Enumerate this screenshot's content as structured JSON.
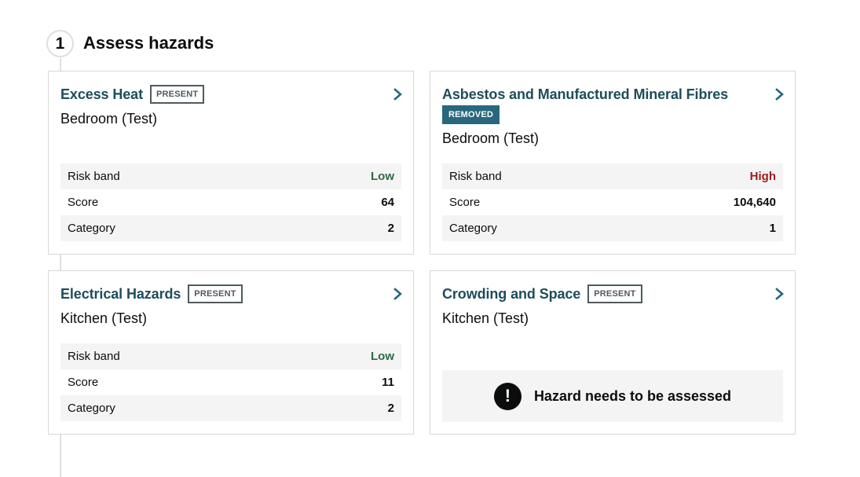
{
  "step": {
    "number": "1",
    "title": "Assess hazards"
  },
  "colors": {
    "link": "#1d4d5c",
    "tag_solid": "#27687e",
    "low": "#2d6a44",
    "high": "#a11d1d"
  },
  "cards": [
    {
      "title": "Excess Heat",
      "tag": "PRESENT",
      "location": "Bedroom (Test)",
      "rows": [
        {
          "label": "Risk band",
          "value": "Low"
        },
        {
          "label": "Score",
          "value": "64"
        },
        {
          "label": "Category",
          "value": "2"
        }
      ]
    },
    {
      "title": "Asbestos and Manufactured Mineral Fibres",
      "tag": "REMOVED",
      "location": "Bedroom (Test)",
      "rows": [
        {
          "label": "Risk band",
          "value": "High"
        },
        {
          "label": "Score",
          "value": "104,640"
        },
        {
          "label": "Category",
          "value": "1"
        }
      ]
    },
    {
      "title": "Electrical Hazards",
      "tag": "PRESENT",
      "location": "Kitchen (Test)",
      "rows": [
        {
          "label": "Risk band",
          "value": "Low"
        },
        {
          "label": "Score",
          "value": "11"
        },
        {
          "label": "Category",
          "value": "2"
        }
      ]
    },
    {
      "title": "Crowding and Space",
      "tag": "PRESENT",
      "location": "Kitchen (Test)",
      "notice": {
        "icon": "exclamation-icon",
        "text": "Hazard needs to be assessed"
      }
    }
  ],
  "icons": {
    "chevron": "chevron-right-icon",
    "notice": "exclamation-icon"
  }
}
